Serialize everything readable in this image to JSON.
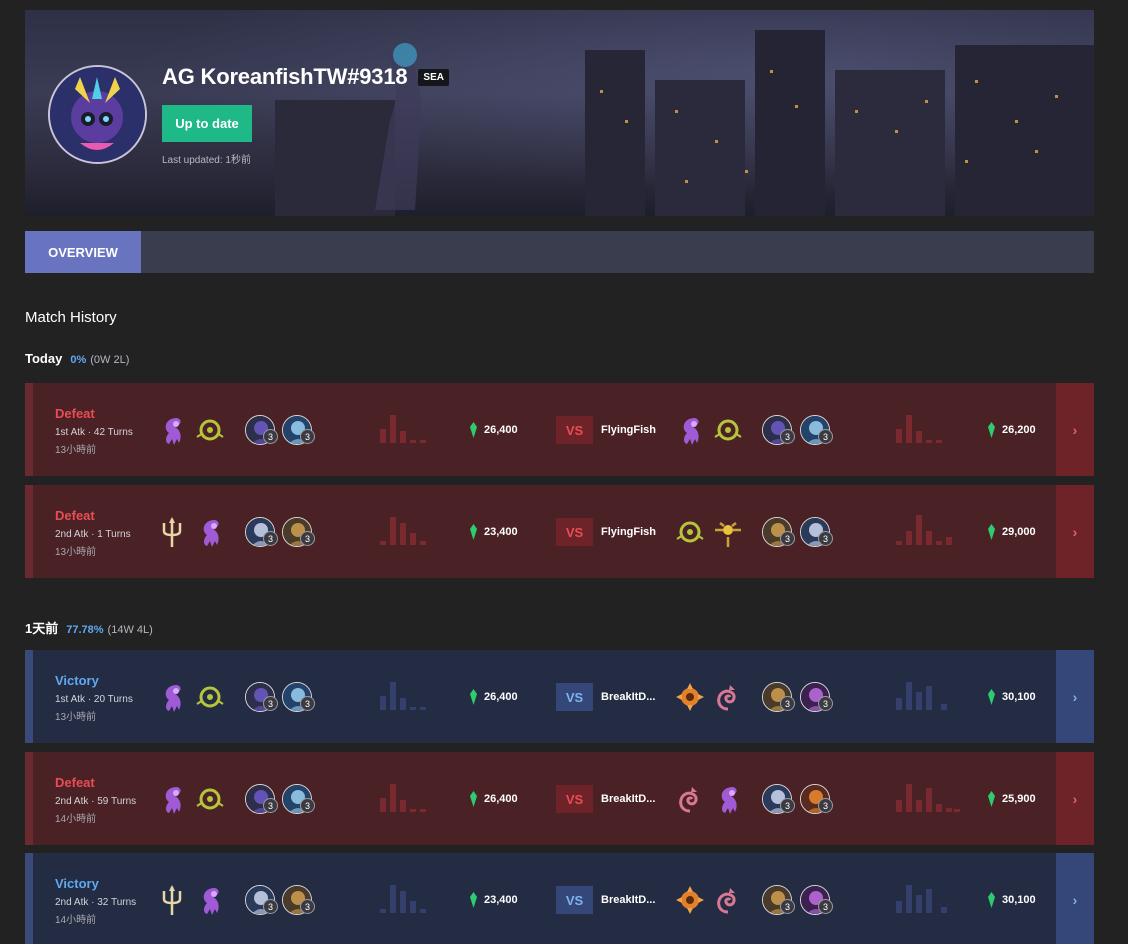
{
  "profile": {
    "name": "AG KoreanfishTW#9318",
    "region": "SEA",
    "update_button": "Up to date",
    "last_updated": "Last updated: 1秒前"
  },
  "tabs": {
    "overview": "OVERVIEW"
  },
  "section_title": "Match History",
  "days": [
    {
      "label": "Today",
      "rate": "0%",
      "record": "(0W 2L)"
    },
    {
      "label": "1天前",
      "rate": "77.78%",
      "record": "(14W 4L)"
    }
  ],
  "matches": [
    {
      "result": "Defeat",
      "attack": "1st Atk · 42 Turns",
      "ago": "13小時前",
      "gold": "26,400",
      "vs": "VS",
      "opponent": "FlyingFish",
      "opp_gold": "26,200",
      "arrow": "›"
    },
    {
      "result": "Defeat",
      "attack": "2nd Atk · 1 Turns",
      "ago": "13小時前",
      "gold": "23,400",
      "vs": "VS",
      "opponent": "FlyingFish",
      "opp_gold": "29,000",
      "arrow": "›"
    },
    {
      "result": "Victory",
      "attack": "1st Atk · 20 Turns",
      "ago": "13小時前",
      "gold": "26,400",
      "vs": "VS",
      "opponent": "BreakItD...",
      "opp_gold": "30,100",
      "arrow": "›"
    },
    {
      "result": "Defeat",
      "attack": "2nd Atk · 59 Turns",
      "ago": "14小時前",
      "gold": "26,400",
      "vs": "VS",
      "opponent": "BreakItD...",
      "opp_gold": "25,900",
      "arrow": "›"
    },
    {
      "result": "Victory",
      "attack": "2nd Atk · 32 Turns",
      "ago": "14小時前",
      "gold": "23,400",
      "vs": "VS",
      "opponent": "BreakItD...",
      "opp_gold": "30,100",
      "arrow": "›"
    }
  ],
  "champion_level": "3",
  "colors": {
    "win": "#5fa9f0",
    "loss": "#e84d55",
    "update_button": "#1fb987",
    "tab_active": "#6974c1",
    "gem": "#2ecc71"
  }
}
